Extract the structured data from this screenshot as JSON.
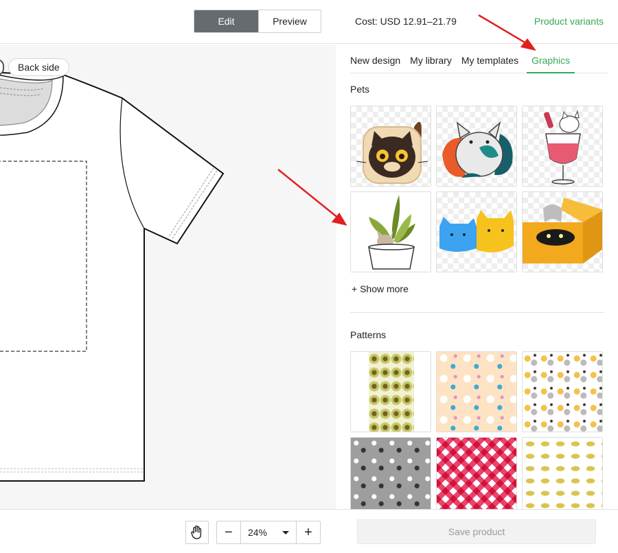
{
  "editor": {
    "mode_edit_label": "Edit",
    "mode_preview_label": "Preview",
    "back_side_label": "Back side",
    "zoom_value": "24%",
    "zoom_out_label": "−",
    "zoom_in_label": "+"
  },
  "panel": {
    "cost": "Cost: USD 12.91–21.79",
    "variants_link": "Product variants",
    "tabs": [
      {
        "label": "New design"
      },
      {
        "label": "My library"
      },
      {
        "label": "My templates"
      },
      {
        "label": "Graphics"
      }
    ],
    "active_tab": "Graphics",
    "sections": {
      "pets_title": "Pets",
      "show_more": "+ Show more",
      "patterns_title": "Patterns"
    },
    "save_label": "Save product"
  },
  "colors": {
    "accent_green": "#35a853",
    "annotation_red": "#e02020",
    "edit_active": "#666b6f"
  },
  "icons": {
    "hand": "hand-icon",
    "caret": "caret-down-icon"
  }
}
